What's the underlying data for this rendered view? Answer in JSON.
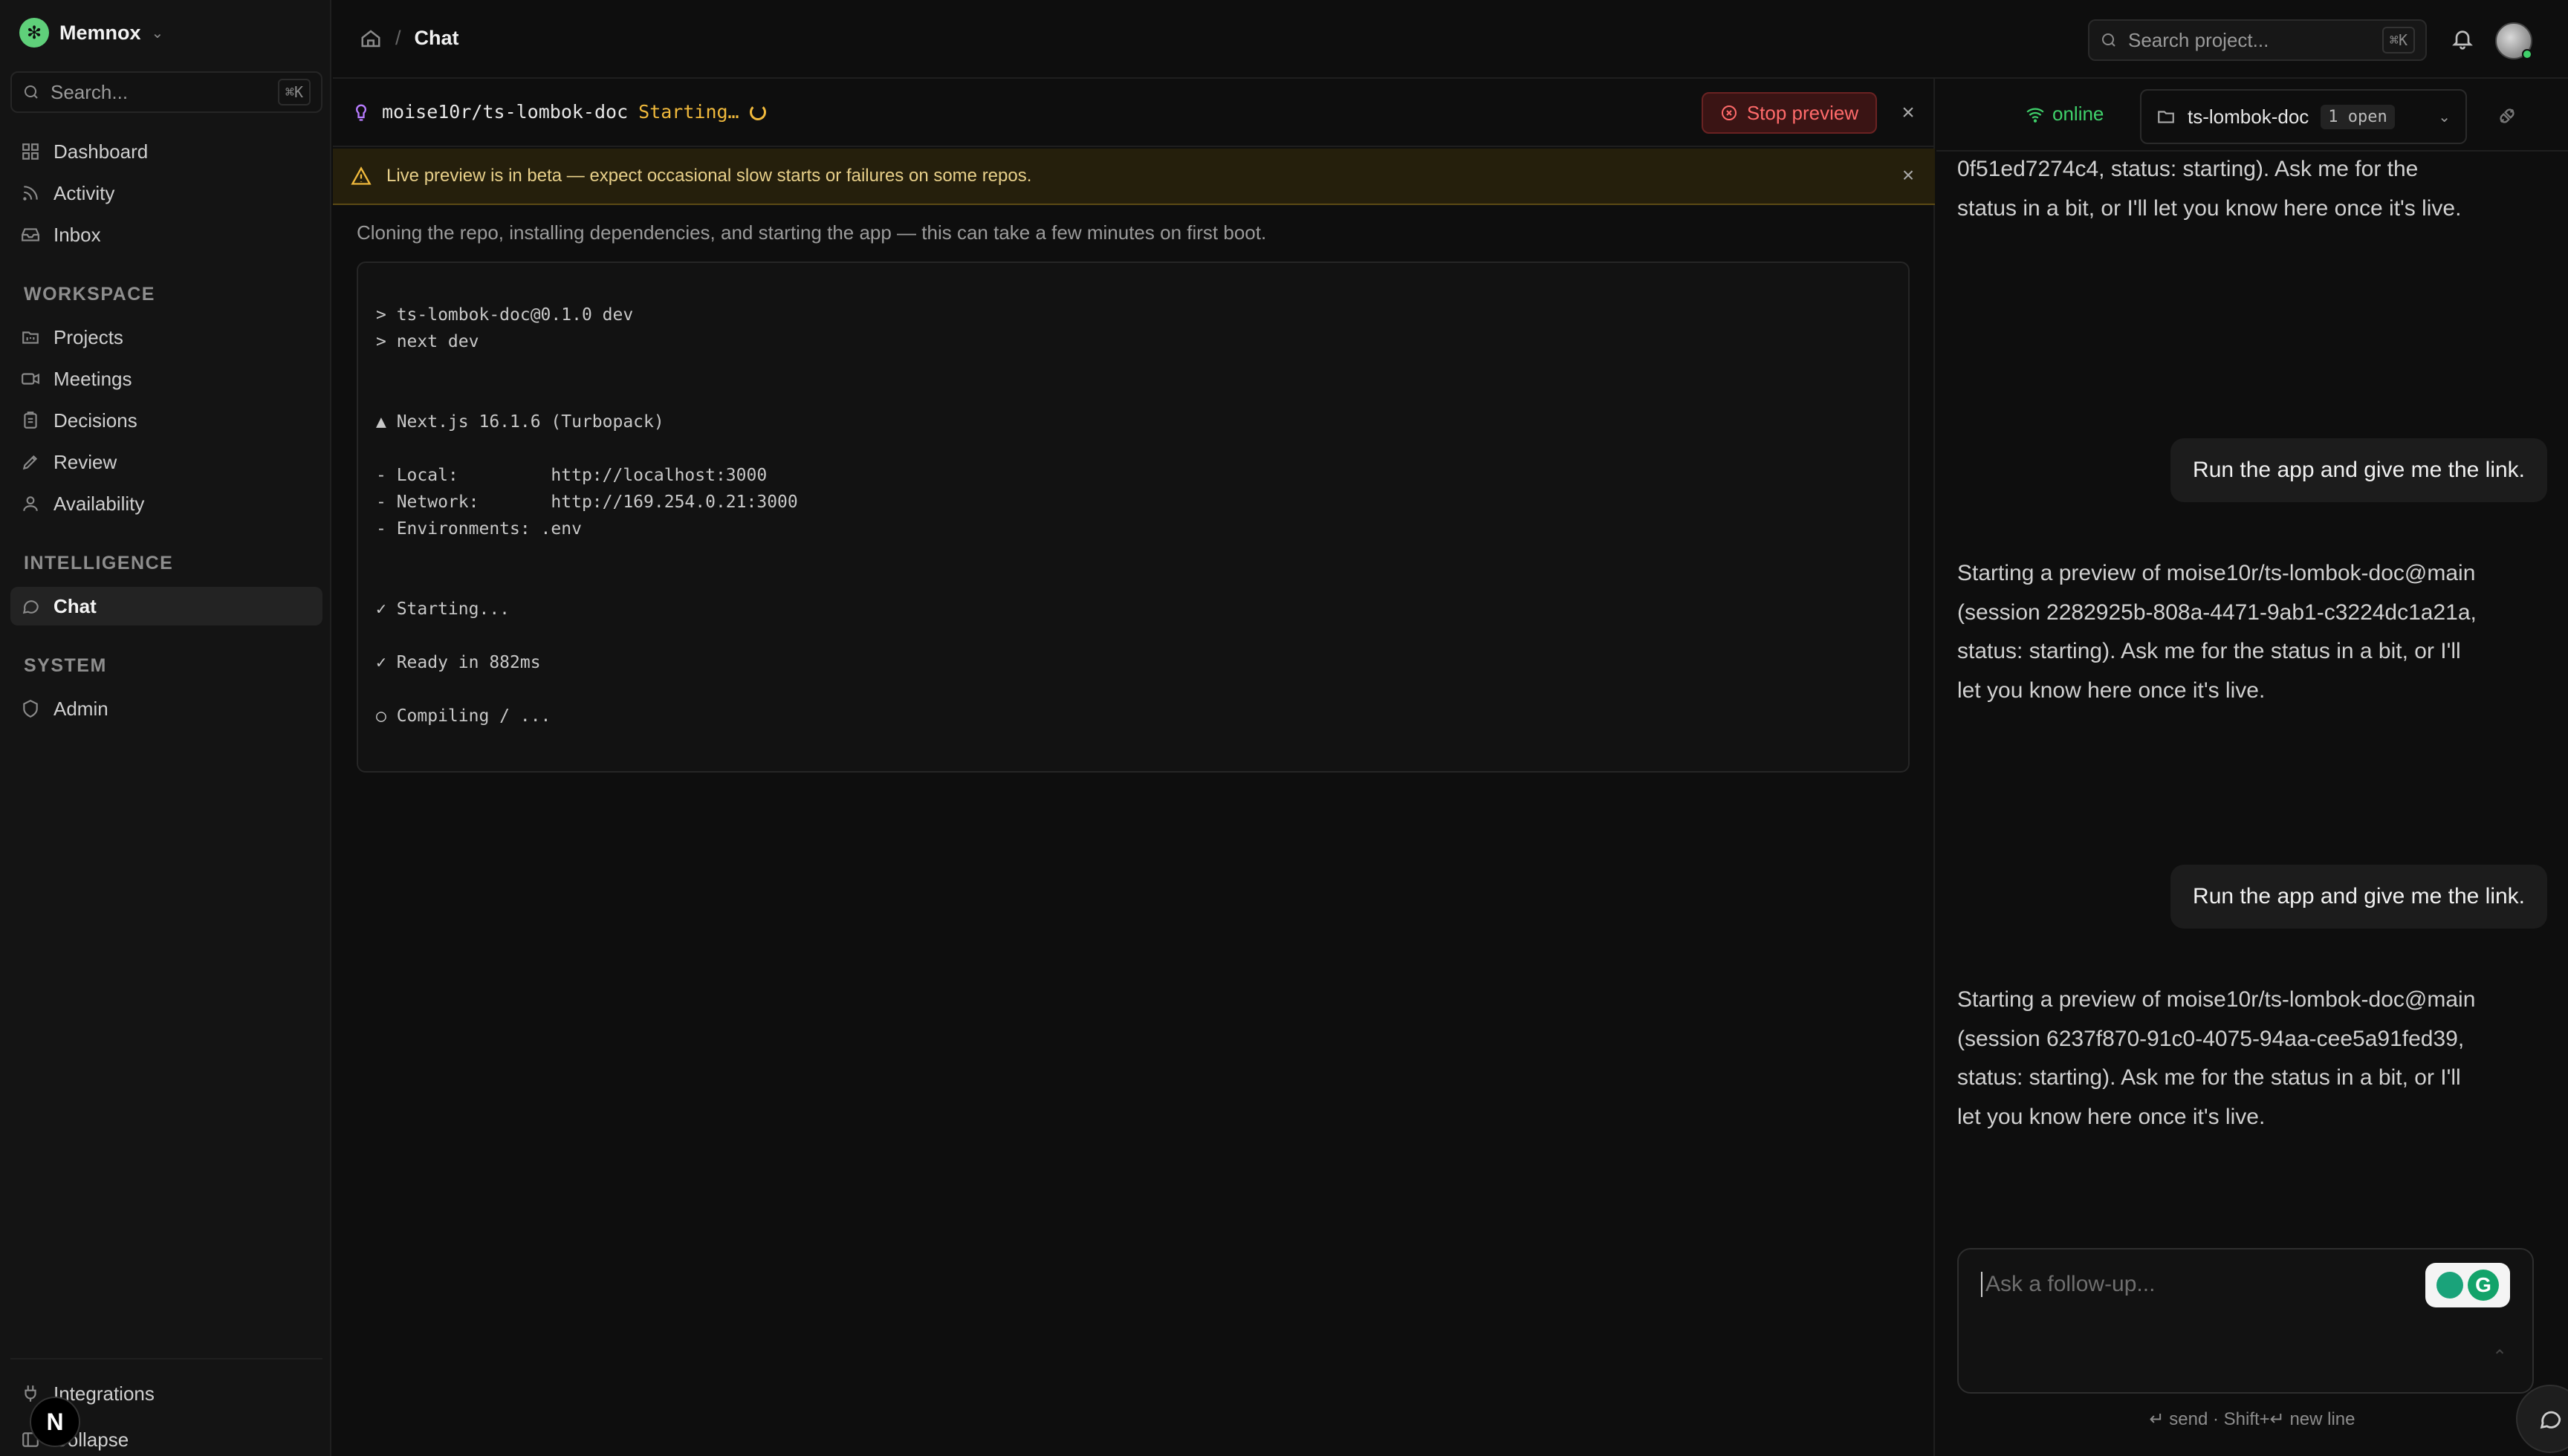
{
  "brand": {
    "name": "Memnox"
  },
  "sidebar": {
    "search_placeholder": "Search...",
    "search_kbd": "⌘K",
    "items": [
      {
        "label": "Dashboard",
        "icon": "grid-icon"
      },
      {
        "label": "Activity",
        "icon": "rss-icon"
      },
      {
        "label": "Inbox",
        "icon": "inbox-icon"
      }
    ],
    "workspace_title": "WORKSPACE",
    "workspace_items": [
      {
        "label": "Projects",
        "icon": "folder-kanban-icon"
      },
      {
        "label": "Meetings",
        "icon": "video-icon"
      },
      {
        "label": "Decisions",
        "icon": "clipboard-icon"
      },
      {
        "label": "Review",
        "icon": "review-icon"
      },
      {
        "label": "Availability",
        "icon": "user-icon"
      }
    ],
    "intelligence_title": "INTELLIGENCE",
    "intelligence_items": [
      {
        "label": "Chat",
        "icon": "chat-icon",
        "active": true
      }
    ],
    "system_title": "SYSTEM",
    "system_items": [
      {
        "label": "Admin",
        "icon": "shield-icon"
      }
    ],
    "bottom_items": [
      {
        "label": "Integrations",
        "icon": "plug-icon"
      },
      {
        "label": "Collapse",
        "icon": "collapse-icon"
      }
    ],
    "n_badge": "N"
  },
  "topbar": {
    "crumb_sep": "/",
    "crumb_current": "Chat",
    "search_placeholder": "Search project...",
    "search_kbd": "⌘K"
  },
  "preview": {
    "repo": "moise10r/ts-lombok-doc",
    "status": "Starting…",
    "stop_label": "Stop preview",
    "beta_text": "Live preview is in beta — expect occasional slow starts or failures on some repos.",
    "info": "Cloning the repo, installing dependencies, and starting the app — this can take a few minutes on first boot.",
    "terminal": [
      "> ts-lombok-doc@0.1.0 dev",
      "> next dev",
      "",
      "",
      "▲ Next.js 16.1.6 (Turbopack)",
      "",
      "- Local:         http://localhost:3000",
      "- Network:       http://169.254.0.21:3000",
      "- Environments: .env",
      "",
      "",
      "✓ Starting...",
      "",
      "✓ Ready in 882ms",
      "",
      "○ Compiling / ..."
    ]
  },
  "chat": {
    "status": "online",
    "project": "ts-lombok-doc",
    "open_badge": "1 open",
    "messages": [
      {
        "role": "assistant",
        "text": "0f51ed7274c4, status: starting). Ask me for the status in a bit, or I'll let you know here once it's live."
      },
      {
        "role": "user",
        "text": "Run the app and give me the link."
      },
      {
        "role": "assistant",
        "text": "Starting a preview of moise10r/ts-lombok-doc@main (session 2282925b-808a-4471-9ab1-c3224dc1a21a, status: starting). Ask me for the status in a bit, or I'll let you know here once it's live."
      },
      {
        "role": "user",
        "text": "Run the app and give me the link."
      },
      {
        "role": "assistant",
        "text": "Starting a preview of moise10r/ts-lombok-doc@main (session 6237f870-91c0-4075-94aa-cee5a91fed39, status: starting). Ask me for the status in a bit, or I'll let you know here once it's live."
      }
    ],
    "composer_placeholder": "Ask a follow-up...",
    "hint": "↵ send · Shift+↵ new line"
  }
}
